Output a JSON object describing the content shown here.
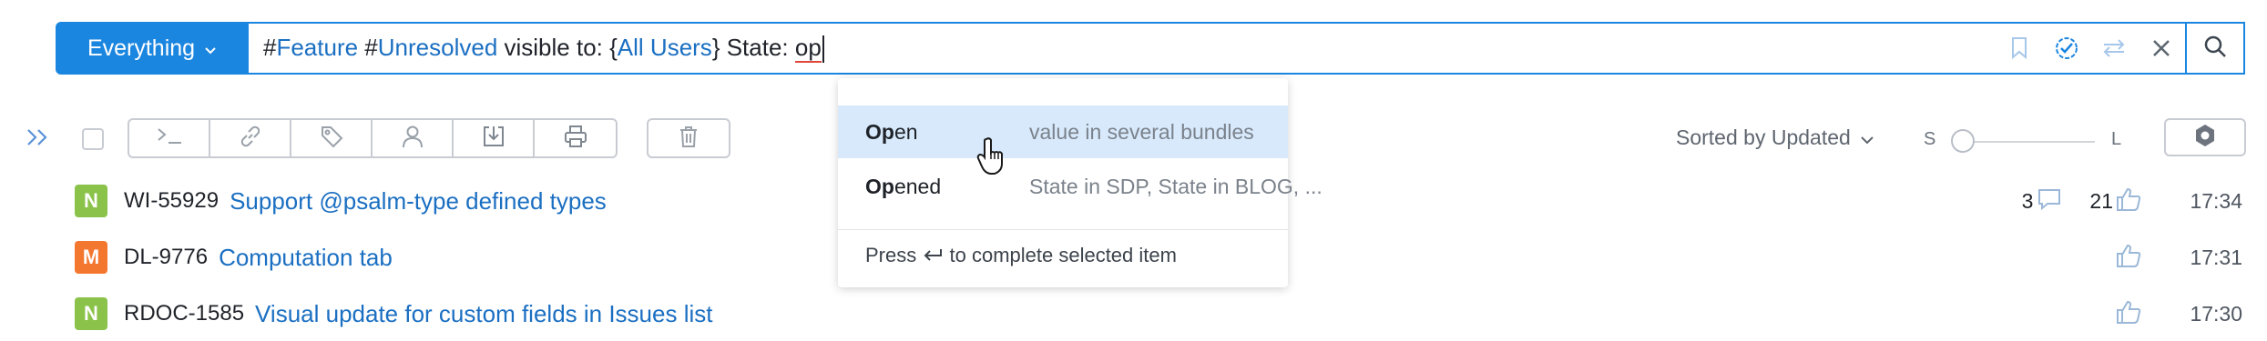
{
  "search": {
    "scope_label": "Everything",
    "query": {
      "hash1": "#",
      "tag1": "Feature",
      "hash2": " #",
      "tag2": "Unresolved",
      "text1": " visible to: {",
      "tag3": "All Users",
      "text2": "} State: ",
      "typed": "op"
    }
  },
  "toolbar": {
    "sort_label": "Sorted by Updated",
    "size_small": "S",
    "size_large": "L",
    "size_level": 0
  },
  "issues": [
    {
      "badge": "N",
      "badge_color": "#8bc34a",
      "id": "WI-55929",
      "title": "Support @psalm-type defined types",
      "comments": "3",
      "votes": "21",
      "time": "17:34"
    },
    {
      "badge": "M",
      "badge_color": "#f4772f",
      "id": "DL-9776",
      "title": "Computation tab",
      "comments": "",
      "votes": "",
      "time": "17:31"
    },
    {
      "badge": "N",
      "badge_color": "#8bc34a",
      "id": "RDOC-1585",
      "title": "Visual update for custom fields in Issues list",
      "comments": "",
      "votes": "",
      "time": "17:30"
    }
  ],
  "autocomplete": {
    "items": [
      {
        "match": "Op",
        "rest": "en",
        "description": "value in several bundles"
      },
      {
        "match": "Op",
        "rest": "ened",
        "description": "State in SDP, State in BLOG, ..."
      }
    ],
    "hint_prefix": "Press",
    "hint_suffix": "to complete selected item"
  },
  "colors": {
    "accent": "#1b86e0",
    "link": "#1b6fc2",
    "selected_row": "#d7e9fb"
  },
  "icons": [
    "chevron-down-icon",
    "bookmark-icon",
    "check-badge-icon",
    "swap-icon",
    "close-icon",
    "search-icon",
    "expand-icon",
    "terminal-icon",
    "link-icon",
    "tag-icon",
    "user-icon",
    "import-icon",
    "print-icon",
    "trash-icon",
    "settings-icon",
    "comment-icon",
    "thumbs-up-icon",
    "enter-key-icon",
    "hand-cursor-icon"
  ]
}
